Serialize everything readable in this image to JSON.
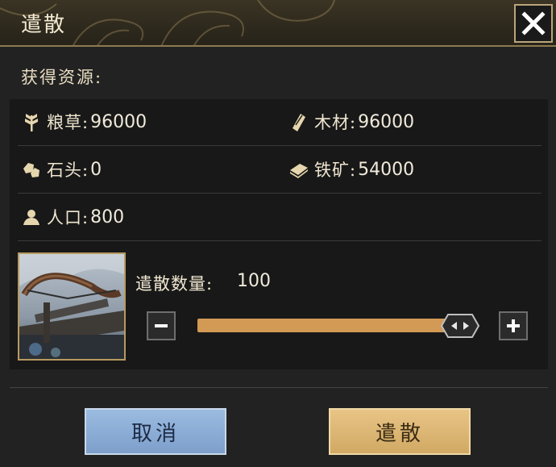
{
  "dialog": {
    "title": "遣散",
    "close_icon": "close-icon"
  },
  "resources": {
    "heading": "获得资源:",
    "items": [
      {
        "icon": "grain-icon",
        "label": "粮草:",
        "value": "96000"
      },
      {
        "icon": "wood-icon",
        "label": "木材:",
        "value": "96000"
      },
      {
        "icon": "stone-icon",
        "label": "石头:",
        "value": "0"
      },
      {
        "icon": "iron-icon",
        "label": "铁矿:",
        "value": "54000"
      },
      {
        "icon": "population-icon",
        "label": "人口:",
        "value": "800"
      }
    ]
  },
  "quantity": {
    "label": "遣散数量:",
    "value": "100",
    "slider_fraction": 1.0,
    "minus_icon": "minus-icon",
    "plus_icon": "plus-icon"
  },
  "buttons": {
    "cancel": "取消",
    "confirm": "遣散"
  },
  "colors": {
    "accent_gold": "#d29a55",
    "cancel_blue": "#8aaed6",
    "confirm_gold": "#ddb673"
  }
}
